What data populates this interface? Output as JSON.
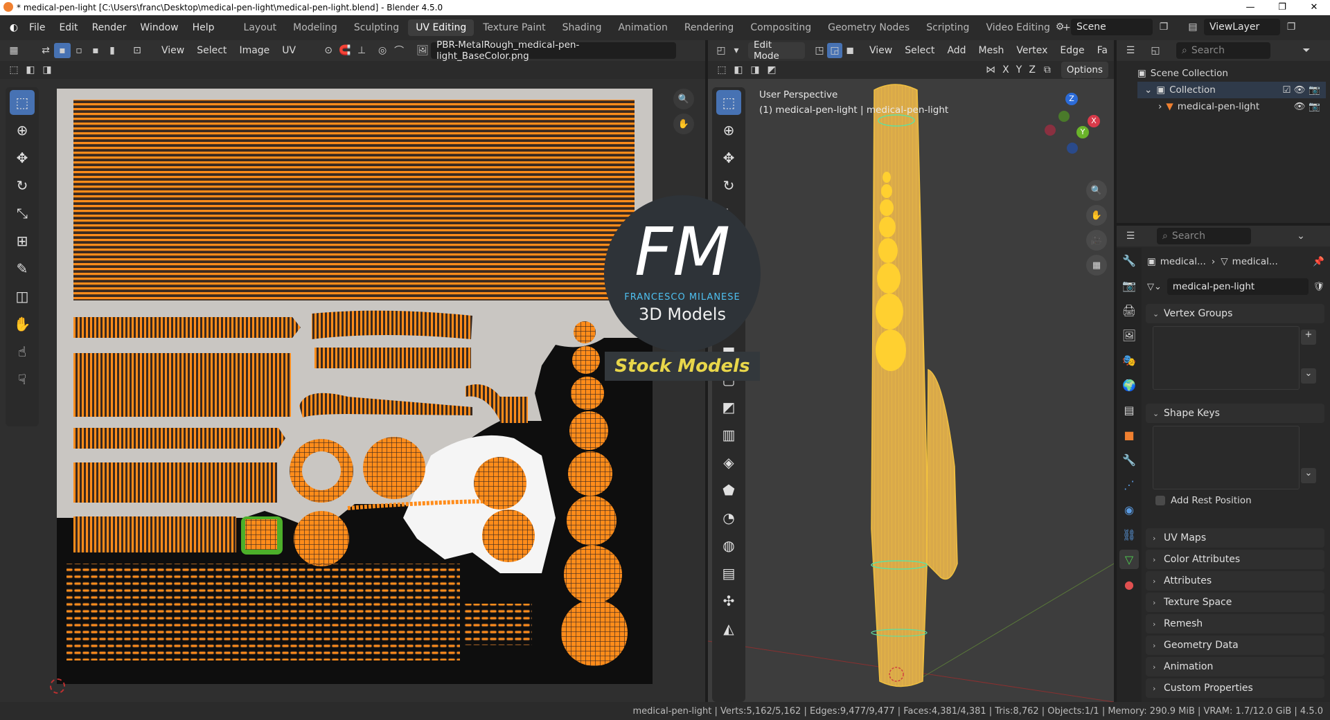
{
  "window": {
    "title": "* medical-pen-light [C:\\Users\\franc\\Desktop\\medical-pen-light\\medical-pen-light.blend] - Blender 4.5.0",
    "minimize": "—",
    "maximize": "❐",
    "close": "✕"
  },
  "menu": [
    "File",
    "Edit",
    "Render",
    "Window",
    "Help"
  ],
  "workspaces": [
    "Layout",
    "Modeling",
    "Sculpting",
    "UV Editing",
    "Texture Paint",
    "Shading",
    "Animation",
    "Rendering",
    "Compositing",
    "Geometry Nodes",
    "Scripting",
    "Video Editing"
  ],
  "active_workspace": "UV Editing",
  "scene": {
    "label": "Scene",
    "view_layer": "ViewLayer"
  },
  "uv_editor": {
    "menus": [
      "View",
      "Select",
      "Image",
      "UV"
    ],
    "image_name": "PBR-MetalRough_medical-pen-light_BaseColor.png"
  },
  "viewport": {
    "mode": "Edit Mode",
    "menus": [
      "View",
      "Select",
      "Add",
      "Mesh",
      "Vertex",
      "Edge",
      "Fa"
    ],
    "axes": [
      "X",
      "Y",
      "Z"
    ],
    "options": "Options",
    "perspective": "User Perspective",
    "object_info": "(1) medical-pen-light | medical-pen-light",
    "gizmo": {
      "x": "X",
      "y": "Y",
      "z": "Z"
    }
  },
  "watermark": {
    "logo": "FM",
    "name": "FRANCESCO MILANESE",
    "subtitle": "3D Models",
    "banner": "Stock Models"
  },
  "outliner": {
    "search_placeholder": "Search",
    "scene_collection": "Scene Collection",
    "collection": "Collection",
    "object": "medical-pen-light"
  },
  "properties": {
    "search_placeholder": "Search",
    "breadcrumb_object": "medical...",
    "breadcrumb_data": "medical...",
    "mesh_name": "medical-pen-light",
    "panels": {
      "vertex_groups": "Vertex Groups",
      "shape_keys": "Shape Keys",
      "add_rest_position": "Add Rest Position",
      "collapsed": [
        "UV Maps",
        "Color Attributes",
        "Attributes",
        "Texture Space",
        "Remesh",
        "Geometry Data",
        "Animation",
        "Custom Properties"
      ]
    }
  },
  "status": "medical-pen-light | Verts:5,162/5,162 | Edges:9,477/9,477 | Faces:4,381/4,381 | Tris:8,762 | Objects:1/1 | Memory: 290.9 MiB | VRAM: 1.7/12.0 GiB | 4.5.0",
  "colors": {
    "accent": "#4772b3",
    "uv_orange": "#ff8c1a",
    "mesh_yellow": "#f0c040",
    "watermark_text": "#e8d64a"
  }
}
